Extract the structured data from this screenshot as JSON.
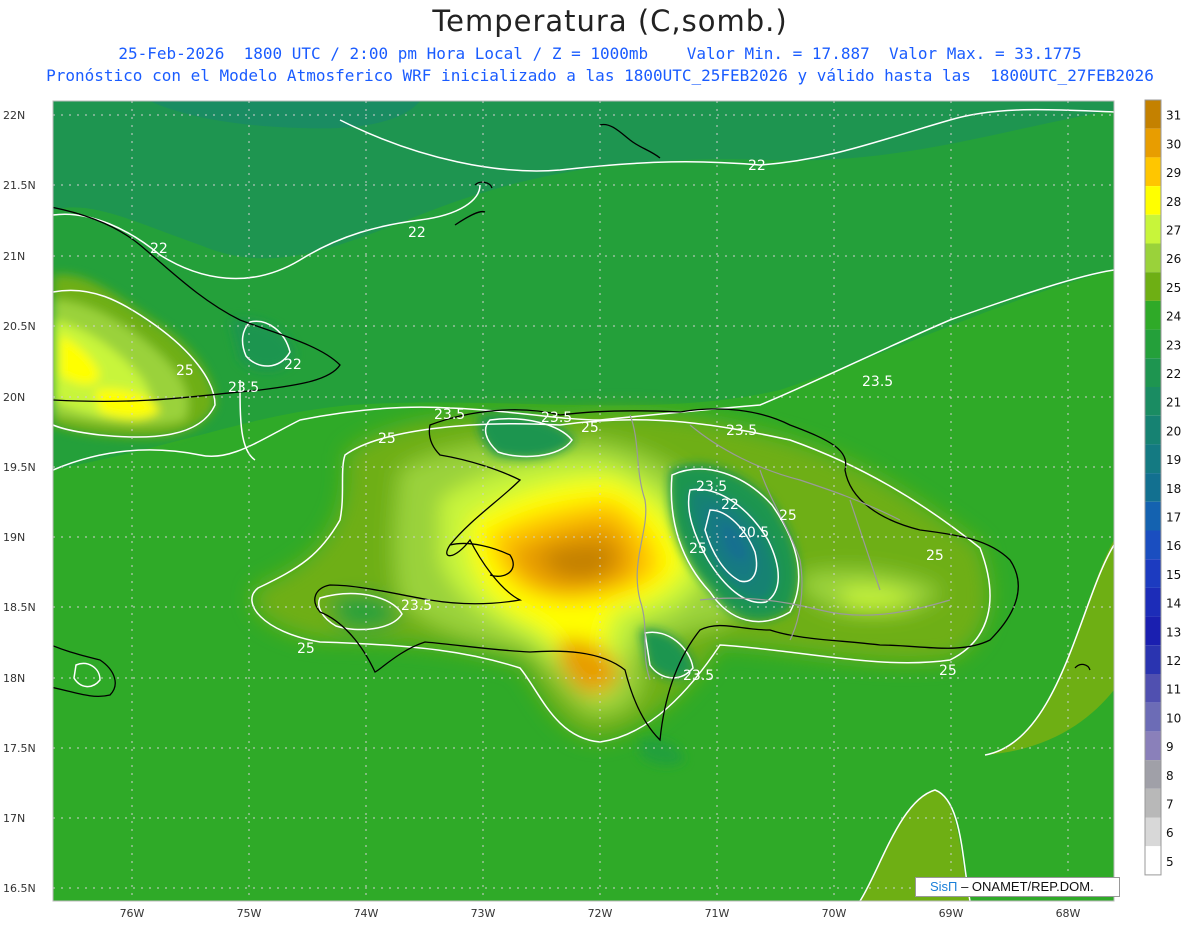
{
  "header": {
    "title": "Temperatura (C,somb.)",
    "subtitle_line1": "25-Feb-2026  1800 UTC / 2:00 pm Hora Local / Z = 1000mb    Valor Min. = 17.887  Valor Max. = 33.1775",
    "subtitle_line2": "Pronóstico con el Modelo Atmosferico WRF inicializado a las 1800UTC_25FEB2026 y válido hasta las  1800UTC_27FEB2026"
  },
  "map": {
    "lat_labels": [
      "22N",
      "21.5N",
      "21N",
      "20.5N",
      "20N",
      "19.5N",
      "19N",
      "18.5N",
      "18N",
      "17.5N",
      "17N",
      "16.5N"
    ],
    "lon_labels": [
      "76W",
      "75W",
      "74W",
      "73W",
      "72W",
      "71W",
      "70W",
      "69W",
      "68W"
    ],
    "isoline_labels": [
      "22",
      "22",
      "22",
      "22",
      "23.5",
      "23.5",
      "23.5",
      "23.5",
      "23.5",
      "23.5",
      "23.5",
      "23.5",
      "25",
      "25",
      "25",
      "25",
      "25",
      "25",
      "25",
      "25",
      "22",
      "20.5"
    ]
  },
  "colorbar": {
    "labels": [
      "31",
      "30",
      "29",
      "28",
      "27",
      "26",
      "25",
      "24",
      "23",
      "22",
      "21",
      "20",
      "19",
      "18",
      "17",
      "16",
      "15",
      "14",
      "13",
      "12",
      "11",
      "10",
      "9",
      "8",
      "7",
      "6",
      "5"
    ],
    "colors": [
      "#c48100",
      "#e89d00",
      "#ffc600",
      "#ffff00",
      "#c8f53a",
      "#9ad23a",
      "#6eaf14",
      "#2faa28",
      "#24a03a",
      "#1e9550",
      "#1a8c62",
      "#168272",
      "#147a82",
      "#127090",
      "#1462b0",
      "#1a4ec0",
      "#1c3bc0",
      "#1c2cb8",
      "#1a1fb0",
      "#2a34b0",
      "#5050b0",
      "#6c6cb6",
      "#8a80ba",
      "#a0a0a8",
      "#b8b8b8",
      "#d8d8d8",
      "#ffffff"
    ]
  },
  "credit": {
    "brand": "SisΠ",
    "text": " – ONAMET/REP.DOM."
  }
}
